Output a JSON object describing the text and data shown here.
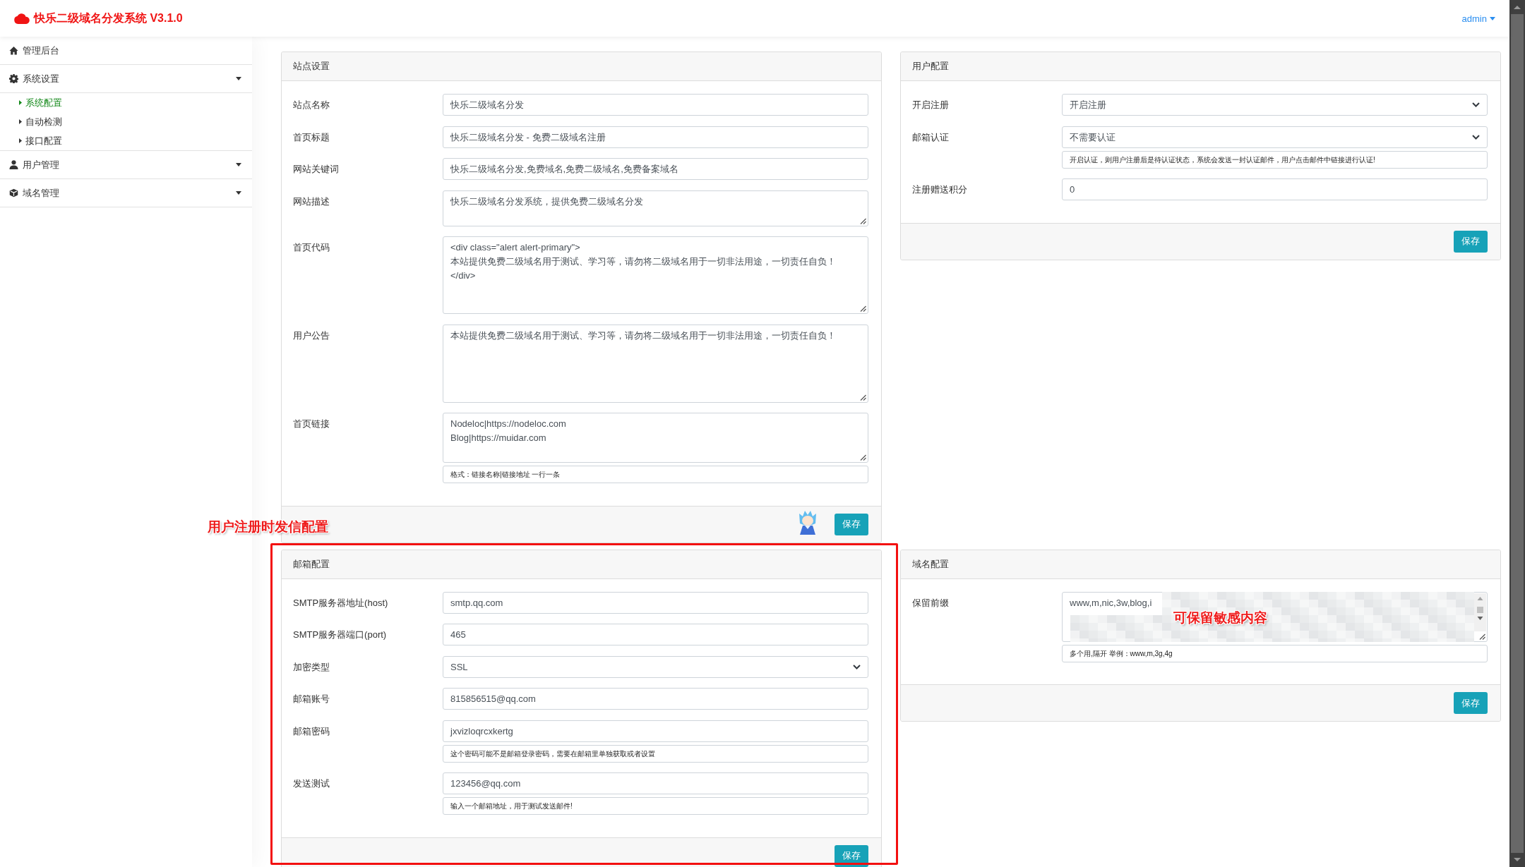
{
  "header": {
    "title": "快乐二级域名分发系统 V3.1.0",
    "user_menu": "admin"
  },
  "sidebar": {
    "items": [
      {
        "label": "管理后台",
        "kind": "link",
        "selected": false
      },
      {
        "label": "系统设置",
        "kind": "menu",
        "selected": false,
        "children": [
          {
            "label": "系统配置",
            "selected": true
          },
          {
            "label": "自动检测",
            "selected": false
          },
          {
            "label": "接口配置",
            "selected": false
          }
        ]
      },
      {
        "label": "用户管理",
        "kind": "menu",
        "selected": false
      },
      {
        "label": "域名管理",
        "kind": "menu",
        "selected": false
      }
    ]
  },
  "panels": [
    {
      "title": "站点设置",
      "rows": [
        {
          "label": "站点名称",
          "kind": "input",
          "value": "快乐二级域名分发"
        },
        {
          "label": "首页标题",
          "kind": "input",
          "value": "快乐二级域名分发 - 免费二级域名注册"
        },
        {
          "label": "网站关键词",
          "kind": "input",
          "value": "快乐二级域名分发,免费域名,免费二级域名,免费备案域名"
        },
        {
          "label": "网站描述",
          "kind": "textarea",
          "value": "快乐二级域名分发系统，提供免费二级域名分发"
        },
        {
          "label": "首页代码",
          "kind": "textarea",
          "value": "<div class=\"alert alert-primary\">\n本站提供免费二级域名用于测试、学习等，请勿将二级域名用于一切非法用途，一切责任自负！\n</div>"
        },
        {
          "label": "用户公告",
          "kind": "textarea",
          "value": "本站提供免费二级域名用于测试、学习等，请勿将二级域名用于一切非法用途，一切责任自负！"
        },
        {
          "label": "首页链接",
          "kind": "textarea",
          "value": "Nodeloc|https://nodeloc.com\nBlog|https://muidar.com",
          "help": "格式：链接名称|链接地址 一行一条"
        }
      ],
      "button": "保存"
    },
    {
      "title": "用户配置",
      "rows": [
        {
          "label": "开启注册",
          "kind": "select",
          "value": "开启注册"
        },
        {
          "label": "邮箱认证",
          "kind": "select",
          "value": "不需要认证",
          "help": "开启认证，则用户注册后是待认证状态，系统会发送一封认证邮件，用户点击邮件中链接进行认证!"
        },
        {
          "label": "注册赠送积分",
          "kind": "input",
          "value": "0"
        }
      ],
      "button": "保存"
    },
    {
      "title": "邮箱配置",
      "rows": [
        {
          "label": "SMTP服务器地址(host)",
          "kind": "input",
          "value": "smtp.qq.com"
        },
        {
          "label": "SMTP服务器端口(port)",
          "kind": "input",
          "value": "465"
        },
        {
          "label": "加密类型",
          "kind": "select",
          "value": "SSL"
        },
        {
          "label": "邮箱账号",
          "kind": "input",
          "value": "815856515@qq.com"
        },
        {
          "label": "邮箱密码",
          "kind": "input",
          "value": "jxvizloqrcxkertg",
          "help": "这个密码可能不是邮箱登录密码，需要在邮箱里单独获取或者设置"
        },
        {
          "label": "发送测试",
          "kind": "input",
          "value": "123456@qq.com",
          "help": "输入一个邮箱地址，用于测试发送邮件!"
        }
      ],
      "button": "保存"
    },
    {
      "title": "域名配置",
      "rows": [
        {
          "label": "保留前缀",
          "kind": "scrolltext",
          "value": "www,m,nic,3w,blog,i",
          "redacted": true,
          "note": "可保留敏感内容",
          "help": "多个用,隔开 举例：www,m,3g,4g"
        }
      ],
      "button": "保存"
    }
  ],
  "annotations": [
    {
      "text": "用户注册时发信配置"
    }
  ]
}
